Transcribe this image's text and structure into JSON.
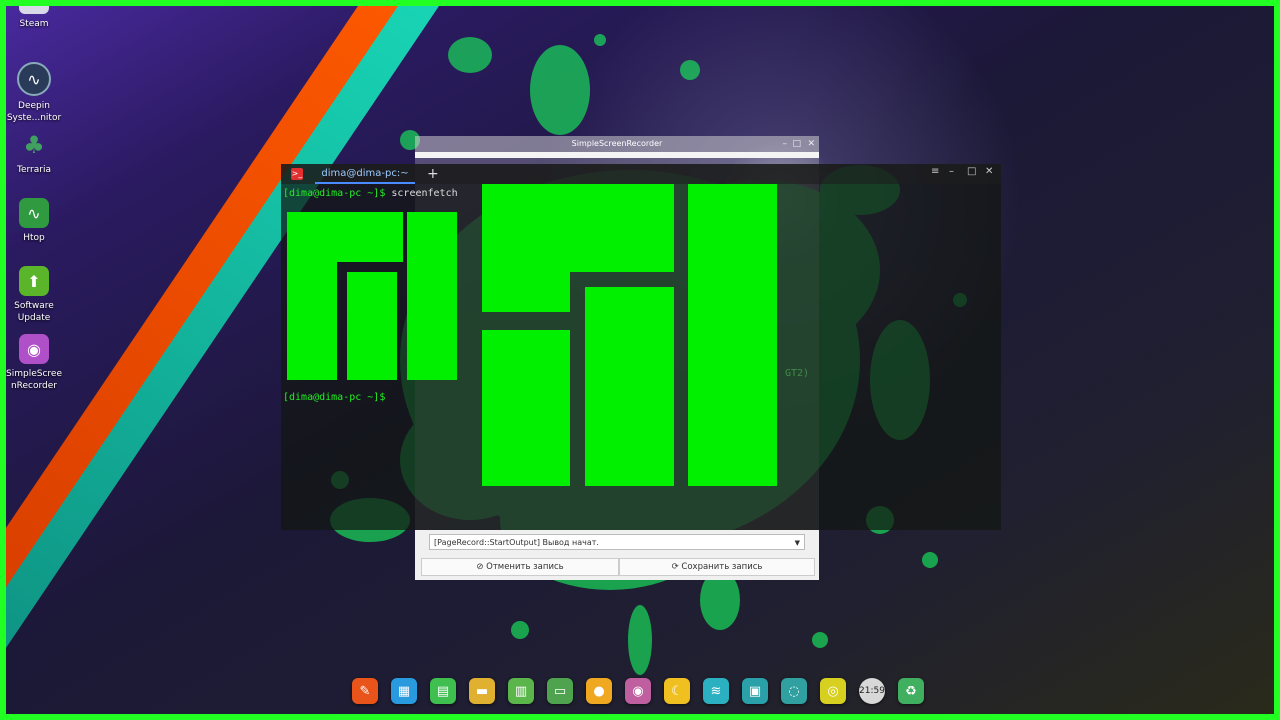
{
  "desktop": {
    "icons": [
      {
        "label": "Steam",
        "icon": "steam-icon"
      },
      {
        "label": "Deepin Syste...nitor",
        "icon": "system-monitor-icon"
      },
      {
        "label": "Terraria",
        "icon": "terraria-tree-icon"
      },
      {
        "label": "Htop",
        "icon": "htop-icon"
      },
      {
        "label": "Software Update",
        "icon": "software-update-icon"
      },
      {
        "label": "SimpleScreenRecorder",
        "icon": "camera-icon"
      }
    ]
  },
  "recorder": {
    "title": "SimpleScreenRecorder",
    "log_text": "[PageRecord::StartOutput] Вывод начат.",
    "cancel_label": "⊘ Отменить запись",
    "save_label": "⟳ Сохранить запись"
  },
  "terminal": {
    "tab_title": "dima@dima-pc:~",
    "add_tab": "+",
    "prompt": "[dima@dima-pc ~]$",
    "command": "screenfetch",
    "prompt2": "[dima@dima-pc ~]$",
    "faint_right": [
      "GT2)"
    ]
  },
  "dock": {
    "items": [
      {
        "icon": "launcher-icon",
        "color": "#e8541a"
      },
      {
        "icon": "calculator-icon",
        "color": "#2a9adf"
      },
      {
        "icon": "spreadsheet-icon",
        "color": "#3fbf4f"
      },
      {
        "icon": "file-manager-icon",
        "color": "#e0b030"
      },
      {
        "icon": "archive-icon",
        "color": "#5ab54a"
      },
      {
        "icon": "battery-icon",
        "color": "#4fa34f"
      },
      {
        "icon": "media-player-icon",
        "color": "#f0a820"
      },
      {
        "icon": "camera-icon",
        "color": "#c05fa0"
      },
      {
        "icon": "night-mode-icon",
        "color": "#f0c020"
      },
      {
        "icon": "wifi-icon",
        "color": "#2ab0c0"
      },
      {
        "icon": "screenshot-icon",
        "color": "#2aa0a8"
      },
      {
        "icon": "updates-icon",
        "color": "#30a0a0"
      },
      {
        "icon": "disc-icon",
        "color": "#d8d020"
      },
      {
        "icon": "clock-icon",
        "color": "#d8d8d8"
      },
      {
        "icon": "trash-icon",
        "color": "#40b060"
      }
    ],
    "clock_text": "21:59"
  },
  "colors": {
    "frame": "#22ff22",
    "logo": "#00f000",
    "prompt": "#22ee22"
  }
}
